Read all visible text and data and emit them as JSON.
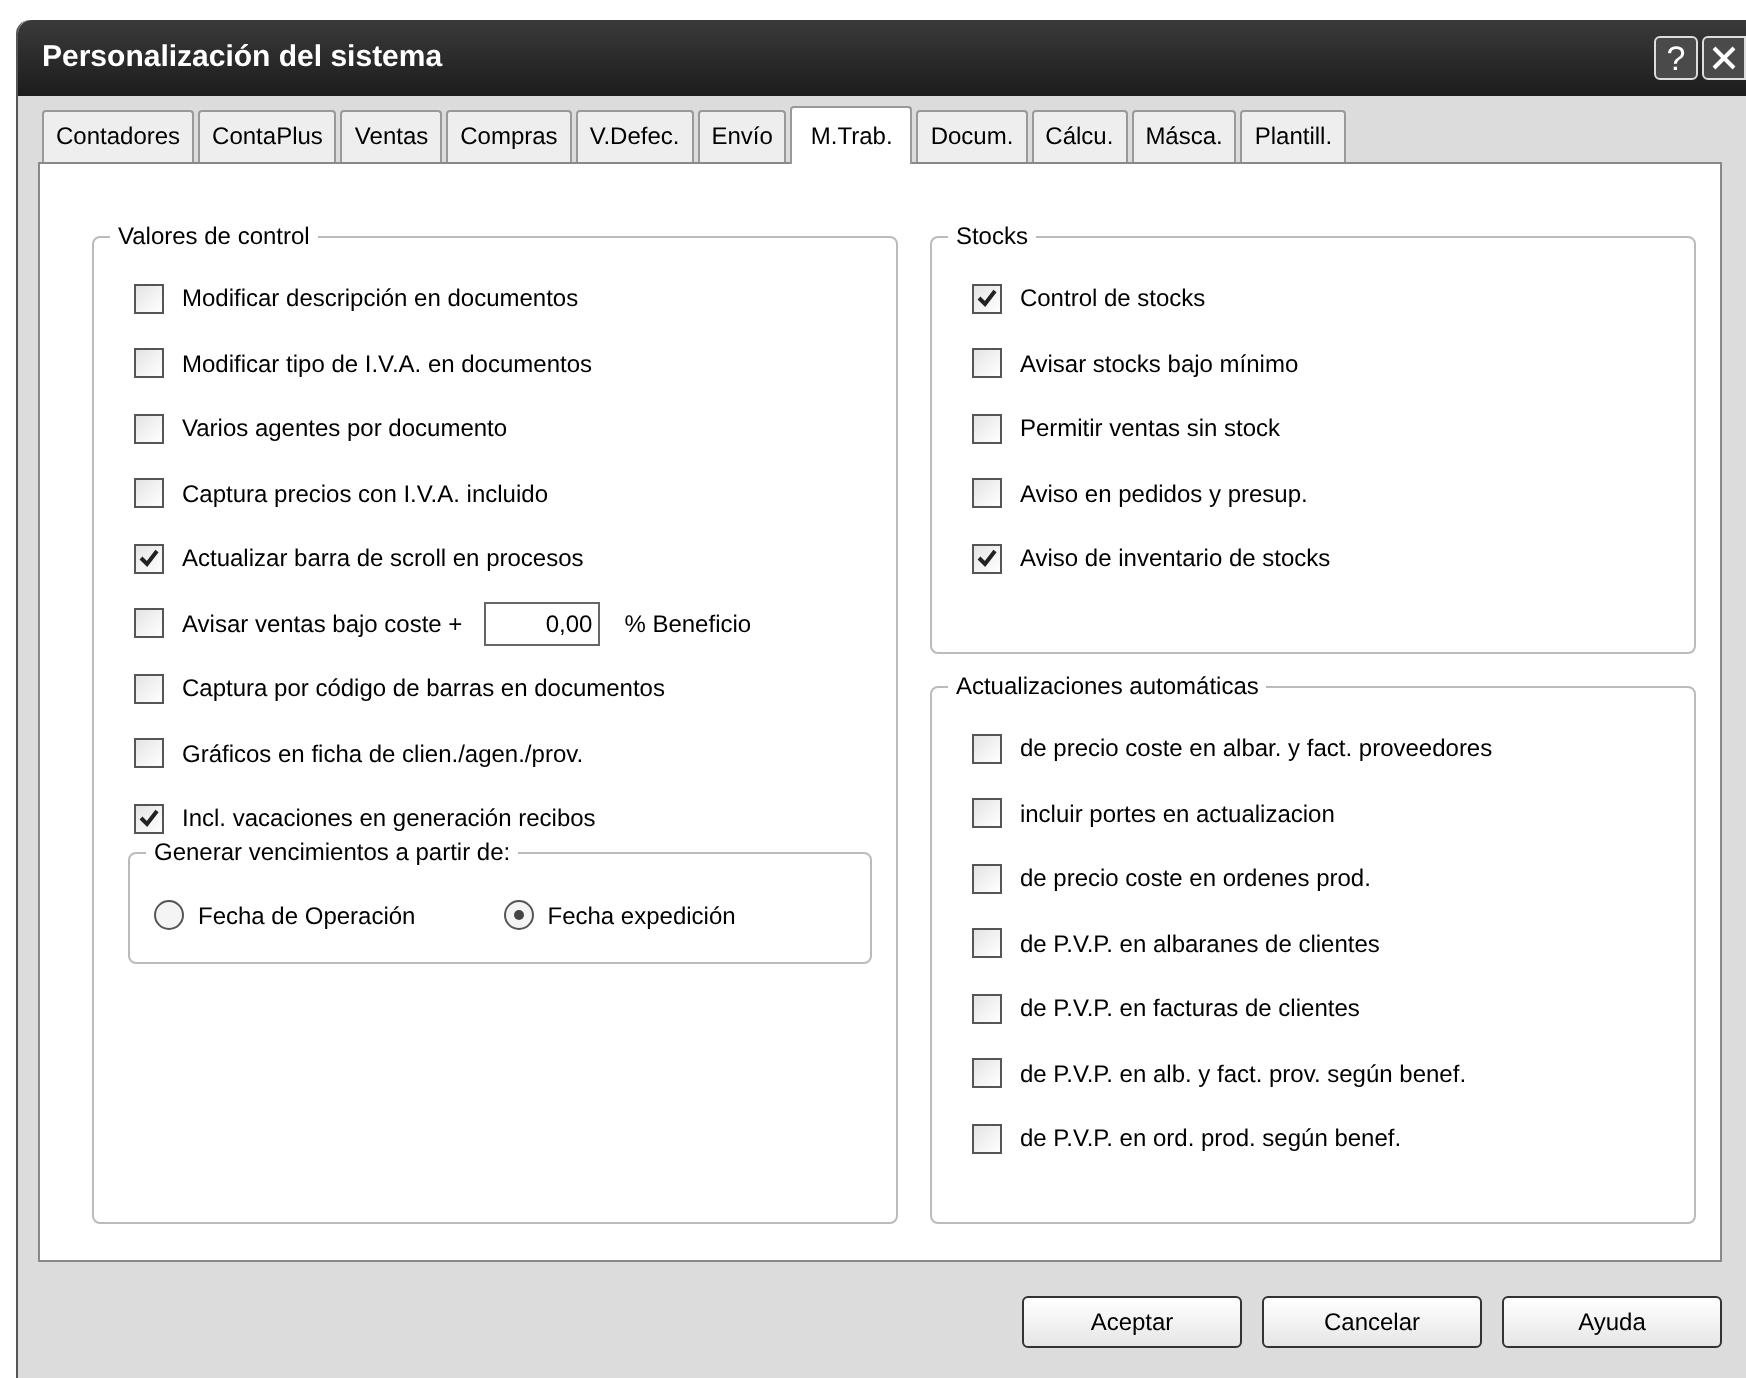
{
  "window": {
    "title": "Personalización del sistema",
    "title_buttons": [
      "?"
    ]
  },
  "tabs": [
    {
      "label": "Contadores",
      "selected": false
    },
    {
      "label": "ContaPlus",
      "selected": false
    },
    {
      "label": "Ventas",
      "selected": false
    },
    {
      "label": "Compras",
      "selected": false
    },
    {
      "label": "V.Defec.",
      "selected": false
    },
    {
      "label": "Envío",
      "selected": false
    },
    {
      "label": "M.Trab.",
      "selected": true
    },
    {
      "label": "Docum.",
      "selected": false
    },
    {
      "label": "Cálcu.",
      "selected": false
    },
    {
      "label": "Másca.",
      "selected": false
    },
    {
      "label": "Plantill.",
      "selected": false
    }
  ],
  "control_values": {
    "title": "Valores de control",
    "items": [
      {
        "kind": "checkbox",
        "label": "Modificar descripción en documentos",
        "checked": false
      },
      {
        "kind": "checkbox",
        "label": "Modificar tipo de I.V.A. en documentos",
        "checked": false
      },
      {
        "kind": "checkbox",
        "label": "Varios agentes por documento",
        "checked": false
      },
      {
        "kind": "checkbox",
        "label": "Captura precios con I.V.A. incluido",
        "checked": false
      },
      {
        "kind": "checkbox",
        "label": "Actualizar barra de scroll en procesos",
        "checked": true
      },
      {
        "kind": "checkbox_field",
        "label": "Avisar ventas bajo coste +",
        "checked": false,
        "value": "0,00",
        "suffix": "% Beneficio"
      },
      {
        "kind": "checkbox",
        "label": "Captura por código de barras en documentos",
        "checked": false
      },
      {
        "kind": "checkbox",
        "label": "Gráficos en ficha de clien./agen./prov.",
        "checked": false
      },
      {
        "kind": "checkbox",
        "label": "Incl. vacaciones en generación recibos",
        "checked": true
      }
    ]
  },
  "due_dates": {
    "title": "Generar vencimientos a partir de:",
    "options": [
      {
        "label": "Fecha de Operación",
        "selected": false
      },
      {
        "label": "Fecha expedición",
        "selected": true
      }
    ]
  },
  "stocks": {
    "title": "Stocks",
    "items": [
      {
        "label": "Control de stocks",
        "checked": true
      },
      {
        "label": "Avisar stocks bajo mínimo",
        "checked": false
      },
      {
        "label": "Permitir ventas sin stock",
        "checked": false
      },
      {
        "label": "Aviso en pedidos y presup.",
        "checked": false
      },
      {
        "label": "Aviso de inventario de stocks",
        "checked": true
      }
    ]
  },
  "auto_updates": {
    "title": "Actualizaciones automáticas",
    "items": [
      {
        "label": "de precio coste en albar. y fact. proveedores",
        "checked": false
      },
      {
        "label": "incluir portes en actualizacion",
        "checked": false
      },
      {
        "label": "de precio coste en ordenes prod.",
        "checked": false
      },
      {
        "label": "de P.V.P. en albaranes de clientes",
        "checked": false
      },
      {
        "label": "de P.V.P. en facturas de clientes",
        "checked": false
      },
      {
        "label": "de P.V.P. en alb. y fact. prov. según benef.",
        "checked": false
      },
      {
        "label": "de P.V.P. en ord. prod. según benef.",
        "checked": false
      }
    ]
  },
  "buttons": [
    "Aceptar",
    "Cancelar",
    "Ayuda"
  ]
}
